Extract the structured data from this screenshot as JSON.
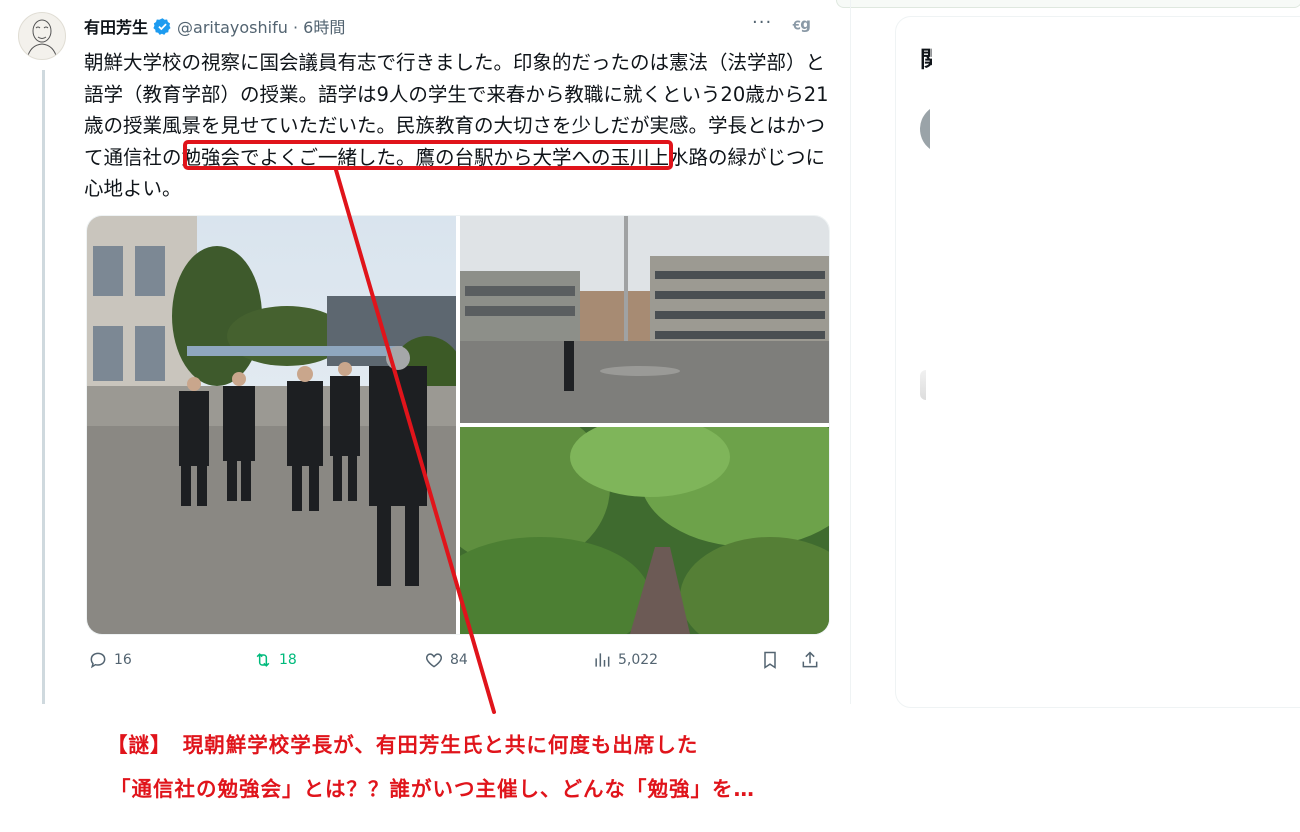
{
  "tweet": {
    "author_name": "有田芳生",
    "handle_time": "@aritayoshifu · 6時間",
    "more": "···",
    "grok": "ꞓg",
    "text_before": "朝鮮大学校の視察に国会議員有志で行きました。印象的だったのは憲法（法学部）と語学（教育学部）の授業。語学は9人の学生で来春から教職に就くという20歳から21歳の授業風景を見せていただいた。民族教育の大切さを少しだが実感。",
    "text_highlight": "学長とはかつて通信社の勉強会でよくご一緒した。",
    "text_after": "鷹の台駅から大学への玉川上水路の緑がじつに心地よい。",
    "actions": {
      "replies": "16",
      "reposts": "18",
      "likes": "84",
      "views": "5,022"
    }
  },
  "right_panel": {
    "heading": "関"
  },
  "annotation": {
    "line1": "【謎】　現朝鮮学校学長が、有田芳生氏と共に何度も出席した",
    "line2": "「通信社の勉強会」とは？？誰がいつ主催し、どんな「勉強」を…"
  },
  "colors": {
    "accent_red": "#e0141b",
    "verified_blue": "#1d9bf0",
    "repost_green": "#00ba7c",
    "secondary_text": "#536471"
  }
}
